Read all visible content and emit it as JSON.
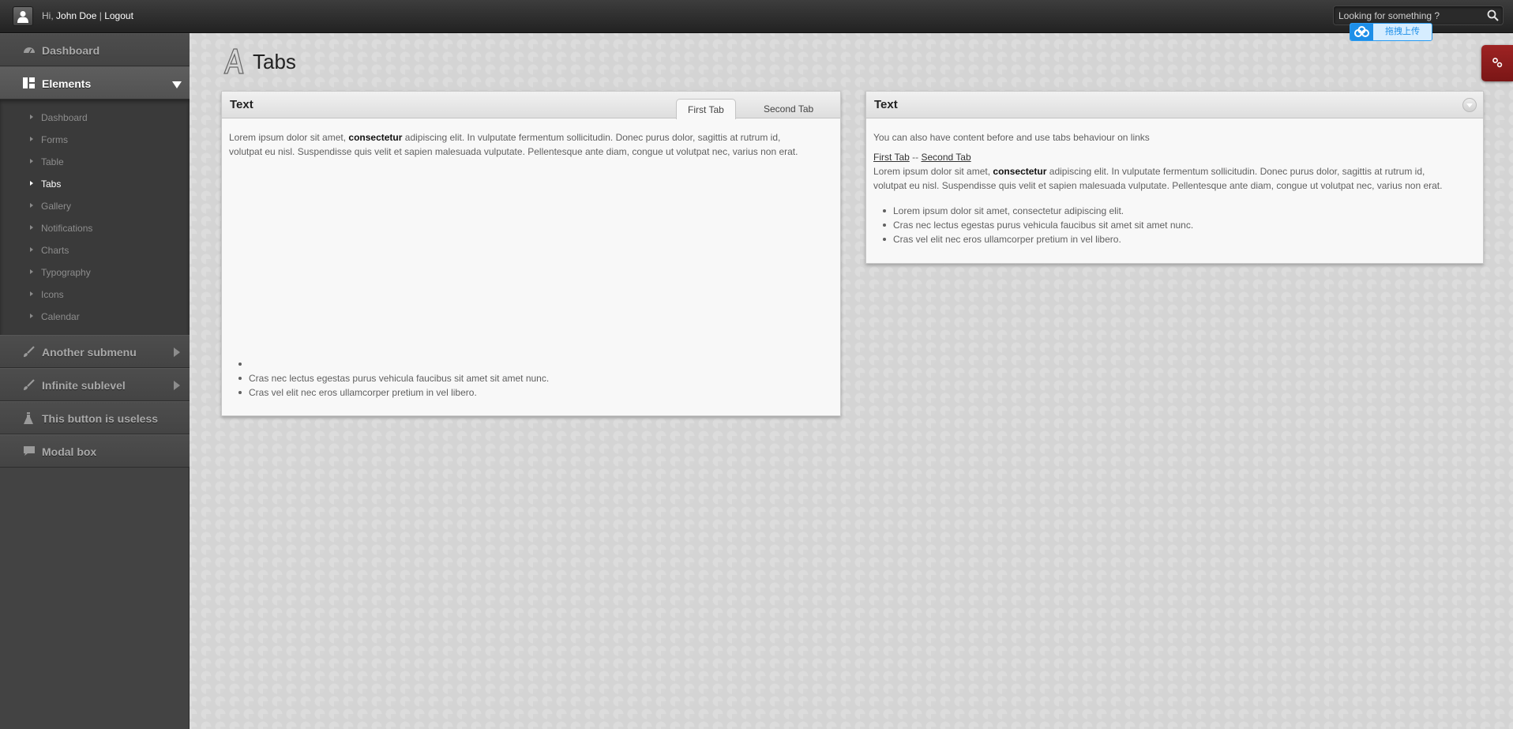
{
  "topbar": {
    "greeting_prefix": "Hi,",
    "user_name": "John Doe",
    "separator": "|",
    "logout_label": "Logout",
    "search_placeholder": "Looking for something ?",
    "upload_badge_label": "拖拽上传"
  },
  "sidebar": {
    "dashboard": "Dashboard",
    "elements": "Elements",
    "elements_sub": [
      "Dashboard",
      "Forms",
      "Table",
      "Tabs",
      "Gallery",
      "Notifications",
      "Charts",
      "Typography",
      "Icons",
      "Calendar"
    ],
    "elements_current": "Tabs",
    "another_submenu": "Another submenu",
    "infinite_sublevel": "Infinite sublevel",
    "useless_button": "This button is useless",
    "modal_box": "Modal box"
  },
  "page": {
    "title": "Tabs"
  },
  "left_panel": {
    "title": "Text",
    "tabs": [
      "First Tab",
      "Second Tab"
    ],
    "active_tab": "First Tab",
    "para_start": "Lorem ipsum dolor sit amet,",
    "para_bold": "consectetur",
    "para_line1_rest": "adipiscing elit. In vulputate fermentum sollicitudin. Donec purus dolor, sagittis at rutrum id,",
    "para_line2": "volutpat eu nisl. Suspendisse quis velit et sapien malesuada vulputate. Pellentesque ante diam, congue ut volutpat nec, varius non erat.",
    "list": [
      "",
      "Cras nec lectus egestas purus vehicula faucibus sit amet sit amet nunc.",
      "Cras vel elit nec eros ullamcorper pretium in vel libero."
    ]
  },
  "right_panel": {
    "title": "Text",
    "intro": "You can also have content before and use tabs behaviour on links",
    "link_first": "First Tab",
    "link_sep": "--",
    "link_second": "Second Tab",
    "para_start": "Lorem ipsum dolor sit amet,",
    "para_bold": "consectetur",
    "para_line1_rest": "adipiscing elit. In vulputate fermentum sollicitudin. Donec purus dolor, sagittis at rutrum id,",
    "para_line2": "volutpat eu nisl. Suspendisse quis velit et sapien malesuada vulputate. Pellentesque ante diam, congue ut volutpat nec, varius non erat.",
    "list": [
      "Lorem ipsum dolor sit amet, consectetur adipiscing elit.",
      "Cras nec lectus egestas purus vehicula faucibus sit amet sit amet nunc.",
      "Cras vel elit nec eros ullamcorper pretium in vel libero."
    ]
  },
  "colors": {
    "topbar": "#2a2a2a",
    "sidebar": "#434343",
    "settings_tab": "#8c1c1c",
    "upload_accent": "#1e8fe8"
  }
}
